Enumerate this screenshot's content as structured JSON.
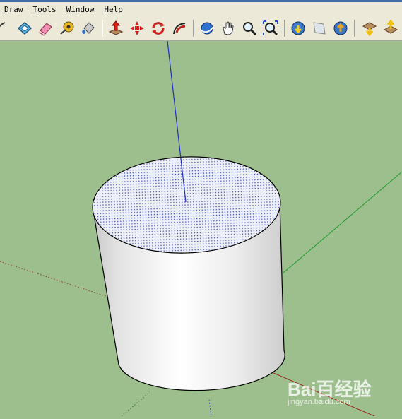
{
  "menubar": {
    "items": [
      {
        "label": "Draw",
        "underline": "D"
      },
      {
        "label": "Tools",
        "underline": "T"
      },
      {
        "label": "Window",
        "underline": "W"
      },
      {
        "label": "Help",
        "underline": "H"
      }
    ]
  },
  "toolbar": {
    "icons": [
      "arc-icon",
      "make-component-icon",
      "eraser-icon",
      "tape-measure-icon",
      "paint-bucket-icon",
      "push-pull-icon",
      "move-icon",
      "rotate-icon",
      "follow-me-icon",
      "orbit-icon",
      "pan-icon",
      "zoom-icon",
      "zoom-extents-icon",
      "get-models-icon",
      "share-model-icon",
      "google-earth-icon",
      "get-components-icon",
      "share-components-icon"
    ]
  },
  "viewport": {
    "background": "#9dbf8e",
    "axis_colors": {
      "blue": "#1f2fbf",
      "green": "#1e9a2a",
      "red": "#a0301f"
    },
    "object": "cylinder"
  },
  "watermark": {
    "brand": "Bai百经验",
    "url": "jingyan.baidu.com"
  }
}
